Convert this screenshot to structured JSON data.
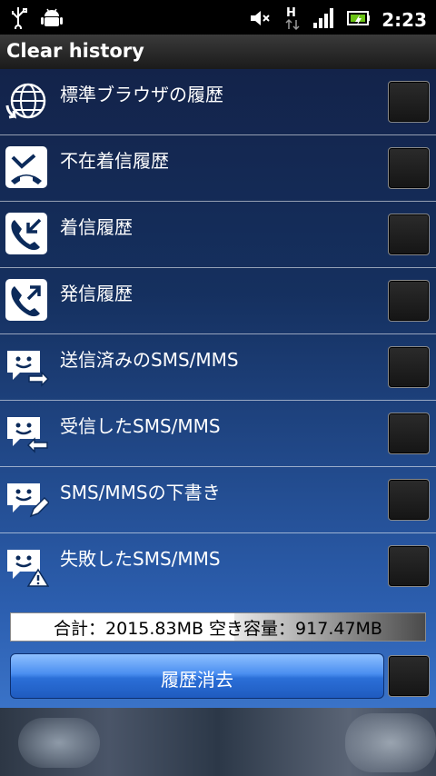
{
  "status_bar": {
    "time": "2:23",
    "icons": [
      "usb-icon",
      "android-debug-icon",
      "mute-icon",
      "hspa-icon",
      "signal-icon",
      "battery-icon"
    ]
  },
  "header": {
    "title": "Clear history"
  },
  "items": [
    {
      "label": "標準ブラウザの履歴",
      "icon": "browser-globe-icon",
      "checked": false
    },
    {
      "label": "不在着信履歴",
      "icon": "missed-call-icon",
      "checked": false
    },
    {
      "label": "着信履歴",
      "icon": "incoming-call-icon",
      "checked": false
    },
    {
      "label": "発信履歴",
      "icon": "outgoing-call-icon",
      "checked": false
    },
    {
      "label": "送信済みのSMS/MMS",
      "icon": "sent-sms-icon",
      "checked": false
    },
    {
      "label": "受信したSMS/MMS",
      "icon": "received-sms-icon",
      "checked": false
    },
    {
      "label": "SMS/MMSの下書き",
      "icon": "draft-sms-icon",
      "checked": false
    },
    {
      "label": "失敗したSMS/MMS",
      "icon": "failed-sms-icon",
      "checked": false
    }
  ],
  "summary": {
    "text": "合計：2015.83MB  空き容量：917.47MB"
  },
  "action": {
    "button_label": "履歴消去",
    "select_all_checked": false
  },
  "colors": {
    "accent": "#2b6fd8",
    "background": "#15305f"
  }
}
